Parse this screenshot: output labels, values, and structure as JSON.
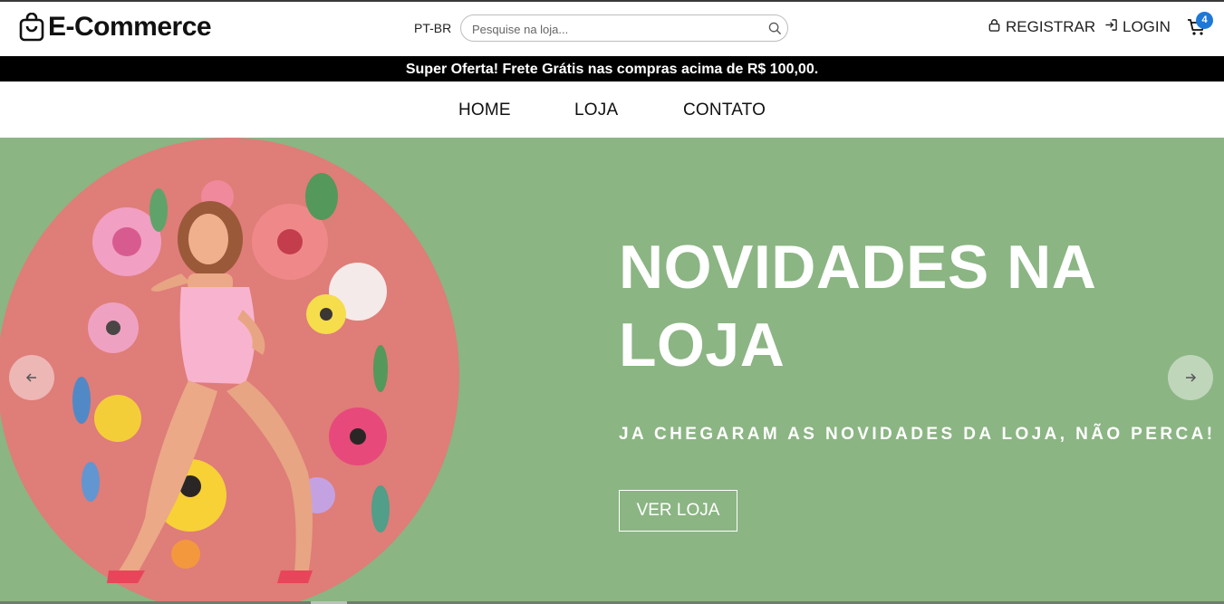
{
  "header": {
    "logo_text": "E-Commerce",
    "logo_icon": "shopping-bag-icon",
    "language": "PT-BR",
    "search_placeholder": "Pesquise na loja...",
    "register_label": "REGISTRAR",
    "login_label": "LOGIN",
    "cart_count": "4",
    "accent_color": "#1e78d7"
  },
  "promo": {
    "text": "Super Oferta! Frete Grátis nas compras acima de R$ 100,00."
  },
  "nav": {
    "items": [
      "HOME",
      "LOJA",
      "CONTATO"
    ]
  },
  "hero": {
    "title": "NOVIDADES NA LOJA",
    "subtitle": "JA CHEGARAM AS NOVIDADES DA LOJA, NÃO PERCA!",
    "button_label": "VER LOJA",
    "background_color": "#8bb583",
    "circle_color": "#df7d78",
    "prev_icon": "arrow-left-icon",
    "next_icon": "arrow-right-icon"
  }
}
